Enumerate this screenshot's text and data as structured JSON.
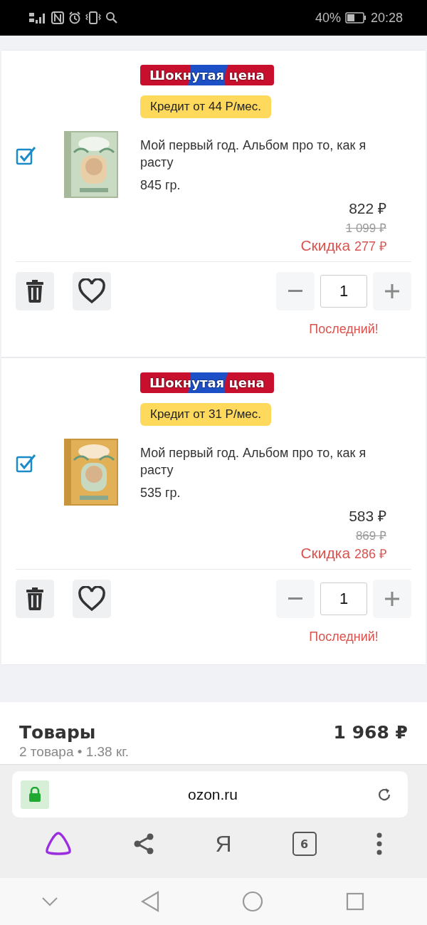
{
  "status_bar": {
    "battery": "40%",
    "time": "20:28"
  },
  "items": [
    {
      "badge": "Шокнутая цена",
      "credit": "Кредит от 44 Р/мес.",
      "checked": true,
      "title": "Мой первый год. Альбом про то, как я расту",
      "weight": "845 гр.",
      "price": "822 ₽",
      "old_price": "1 099 ₽",
      "discount_label": "Скидка",
      "discount": "277 ₽",
      "quantity": "1",
      "note": "Последний!"
    },
    {
      "badge": "Шокнутая цена",
      "credit": "Кредит от 31 Р/мес.",
      "checked": true,
      "title": "Мой первый год. Альбом про то, как я расту",
      "weight": "535 гр.",
      "price": "583 ₽",
      "old_price": "869 ₽",
      "discount_label": "Скидка",
      "discount": "286 ₽",
      "quantity": "1",
      "note": "Последний!"
    }
  ],
  "summary": {
    "title": "Товары",
    "total": "1 968 ₽",
    "details": "2 товара • 1.38 кг."
  },
  "browser": {
    "url": "ozon.ru",
    "tabs_count": "6",
    "yandex": "Я"
  }
}
